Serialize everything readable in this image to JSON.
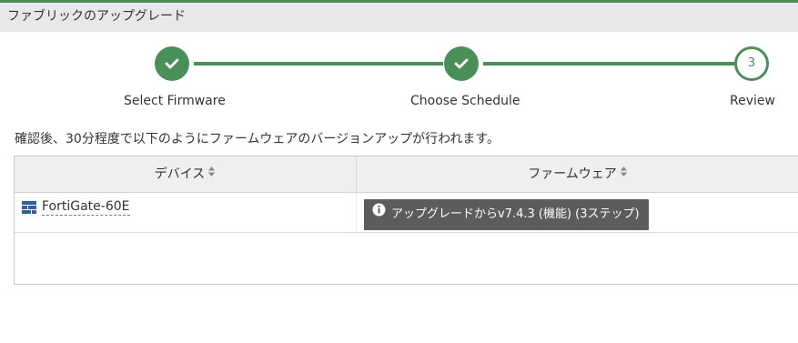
{
  "title": "ファブリックのアップグレード",
  "steps": [
    {
      "label": "Select Firmware",
      "state": "done",
      "icon": "check-icon"
    },
    {
      "label": "Choose Schedule",
      "state": "done",
      "icon": "check-icon"
    },
    {
      "label": "Review",
      "state": "current",
      "number": "3"
    }
  ],
  "description": "確認後、30分程度で以下のようにファームウェアのバージョンアップが行われます。",
  "table": {
    "columns": [
      {
        "label": "デバイス",
        "icon": "sort-icon"
      },
      {
        "label": "ファームウェア",
        "icon": "sort-icon"
      }
    ],
    "rows": [
      {
        "device": "FortiGate-60E",
        "device_icon": "fortigate-device-icon",
        "firmware_badge": "アップグレードからv7.4.3 (機能) (3ステップ)",
        "badge_icon": "info-icon"
      }
    ]
  },
  "colors": {
    "accent": "#4a8f5a",
    "badge_bg": "#5c5c5c",
    "header_bg": "#e8e8e8"
  }
}
